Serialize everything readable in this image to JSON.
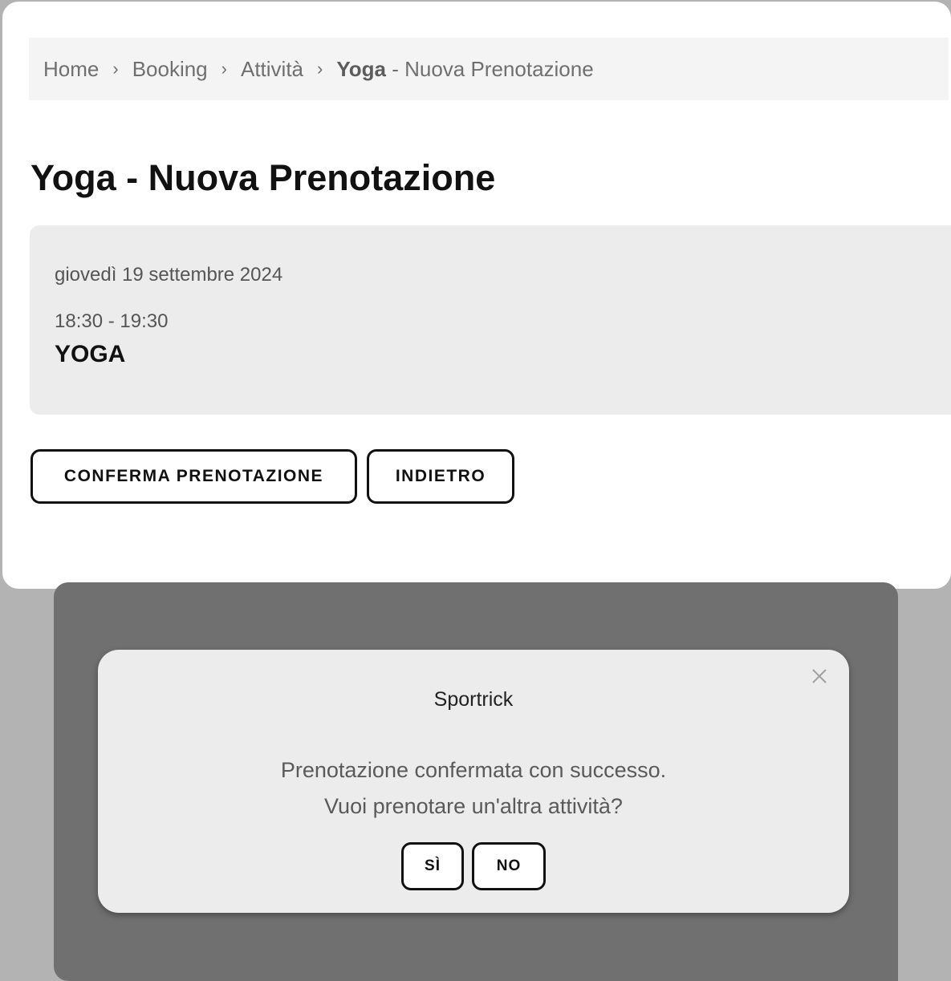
{
  "breadcrumb": {
    "items": [
      "Home",
      "Booking",
      "Attività"
    ],
    "separator": "›",
    "current_bold": "Yoga",
    "current_rest": " - Nuova Prenotazione"
  },
  "page": {
    "title": "Yoga - Nuova Prenotazione"
  },
  "booking": {
    "date": "giovedì 19 settembre 2024",
    "time": "18:30 - 19:30",
    "activity": "YOGA"
  },
  "actions": {
    "confirm_label": "CONFERMA PRENOTAZIONE",
    "back_label": "INDIETRO"
  },
  "modal": {
    "title": "Sportrick",
    "message_line1": "Prenotazione confermata con successo.",
    "message_line2": "Vuoi prenotare un'altra attività?",
    "yes_label": "SÌ",
    "no_label": "NO",
    "close_icon": "close-icon"
  },
  "colors": {
    "overlay": "#707070",
    "modal_bg": "#ececec",
    "button_border": "#111111"
  }
}
